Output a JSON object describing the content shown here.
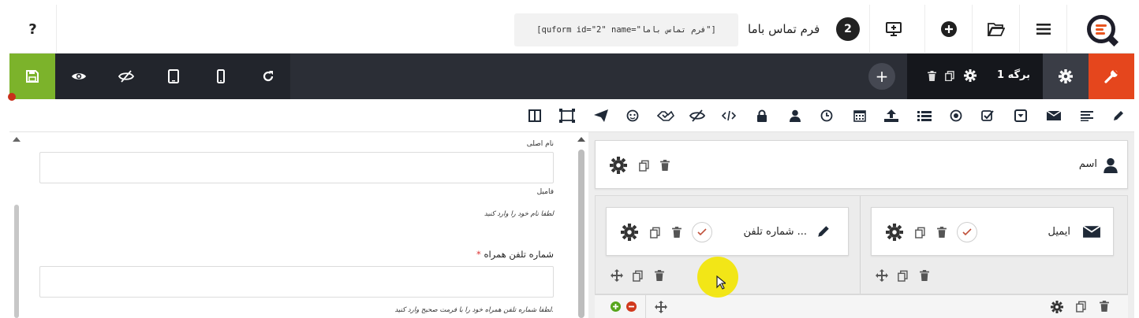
{
  "header": {
    "help_label": "?",
    "shortcode": "[quform id=\"2\" name=\"فرم تماس باما\"]",
    "form_title": "فرم تماس باما",
    "form_id": "2",
    "icons": [
      "preview-screen-icon",
      "add-circle-icon",
      "folder-open-icon",
      "menu-icon",
      "quform-logo-icon"
    ]
  },
  "toolbar": {
    "page_tab_label": "برگه 1",
    "add_page_label": "+",
    "colors": {
      "save": "#7cb32b",
      "tools": "#e5461d",
      "dark": "#2b2e36"
    }
  },
  "palette": {
    "items": [
      "pencil-icon",
      "paragraph-icon",
      "envelope-icon",
      "dropdown-icon",
      "checkbox-icon",
      "radio-icon",
      "list-icon",
      "upload-icon",
      "calendar-icon",
      "clock-icon",
      "user-icon",
      "lock-icon",
      "code-icon",
      "hidden-icon",
      "captcha-icon",
      "recaptcha-icon",
      "send-icon",
      "group-icon",
      "columns-icon"
    ]
  },
  "preview": {
    "field1_label": "نام اصلی",
    "field2_label": "فامیل",
    "field2_help": "لطفا نام خود را وارد کنید",
    "phone_label": "شماره تلفن همراه",
    "required_mark": "*",
    "phone_help": "لطفا شماره تلفن همراه خود را با فرمت صحیح وارد کنید."
  },
  "builder": {
    "name_field_label": "اسم",
    "email_field_label": "ایمیل",
    "phone_field_label": "شماره تلفن ..."
  }
}
